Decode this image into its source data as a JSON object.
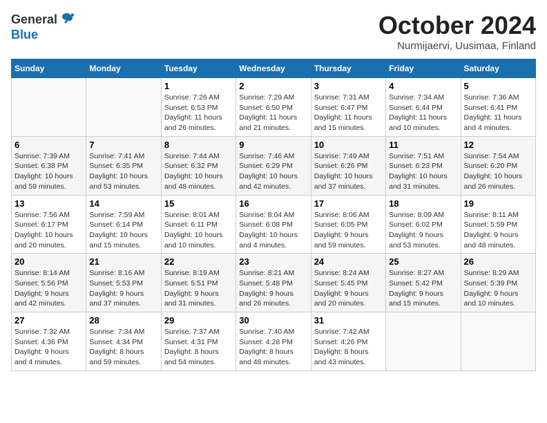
{
  "header": {
    "logo_general": "General",
    "logo_blue": "Blue",
    "month_title": "October 2024",
    "location": "Nurmijaervi, Uusimaa, Finland"
  },
  "weekdays": [
    "Sunday",
    "Monday",
    "Tuesday",
    "Wednesday",
    "Thursday",
    "Friday",
    "Saturday"
  ],
  "weeks": [
    [
      {
        "day": "",
        "info": ""
      },
      {
        "day": "",
        "info": ""
      },
      {
        "day": "1",
        "info": "Sunrise: 7:26 AM\nSunset: 6:53 PM\nDaylight: 11 hours\nand 26 minutes."
      },
      {
        "day": "2",
        "info": "Sunrise: 7:29 AM\nSunset: 6:50 PM\nDaylight: 11 hours\nand 21 minutes."
      },
      {
        "day": "3",
        "info": "Sunrise: 7:31 AM\nSunset: 6:47 PM\nDaylight: 11 hours\nand 15 minutes."
      },
      {
        "day": "4",
        "info": "Sunrise: 7:34 AM\nSunset: 6:44 PM\nDaylight: 11 hours\nand 10 minutes."
      },
      {
        "day": "5",
        "info": "Sunrise: 7:36 AM\nSunset: 6:41 PM\nDaylight: 11 hours\nand 4 minutes."
      }
    ],
    [
      {
        "day": "6",
        "info": "Sunrise: 7:39 AM\nSunset: 6:38 PM\nDaylight: 10 hours\nand 59 minutes."
      },
      {
        "day": "7",
        "info": "Sunrise: 7:41 AM\nSunset: 6:35 PM\nDaylight: 10 hours\nand 53 minutes."
      },
      {
        "day": "8",
        "info": "Sunrise: 7:44 AM\nSunset: 6:32 PM\nDaylight: 10 hours\nand 48 minutes."
      },
      {
        "day": "9",
        "info": "Sunrise: 7:46 AM\nSunset: 6:29 PM\nDaylight: 10 hours\nand 42 minutes."
      },
      {
        "day": "10",
        "info": "Sunrise: 7:49 AM\nSunset: 6:26 PM\nDaylight: 10 hours\nand 37 minutes."
      },
      {
        "day": "11",
        "info": "Sunrise: 7:51 AM\nSunset: 6:23 PM\nDaylight: 10 hours\nand 31 minutes."
      },
      {
        "day": "12",
        "info": "Sunrise: 7:54 AM\nSunset: 6:20 PM\nDaylight: 10 hours\nand 26 minutes."
      }
    ],
    [
      {
        "day": "13",
        "info": "Sunrise: 7:56 AM\nSunset: 6:17 PM\nDaylight: 10 hours\nand 20 minutes."
      },
      {
        "day": "14",
        "info": "Sunrise: 7:59 AM\nSunset: 6:14 PM\nDaylight: 10 hours\nand 15 minutes."
      },
      {
        "day": "15",
        "info": "Sunrise: 8:01 AM\nSunset: 6:11 PM\nDaylight: 10 hours\nand 10 minutes."
      },
      {
        "day": "16",
        "info": "Sunrise: 8:04 AM\nSunset: 6:08 PM\nDaylight: 10 hours\nand 4 minutes."
      },
      {
        "day": "17",
        "info": "Sunrise: 8:06 AM\nSunset: 6:05 PM\nDaylight: 9 hours\nand 59 minutes."
      },
      {
        "day": "18",
        "info": "Sunrise: 8:09 AM\nSunset: 6:02 PM\nDaylight: 9 hours\nand 53 minutes."
      },
      {
        "day": "19",
        "info": "Sunrise: 8:11 AM\nSunset: 5:59 PM\nDaylight: 9 hours\nand 48 minutes."
      }
    ],
    [
      {
        "day": "20",
        "info": "Sunrise: 8:14 AM\nSunset: 5:56 PM\nDaylight: 9 hours\nand 42 minutes."
      },
      {
        "day": "21",
        "info": "Sunrise: 8:16 AM\nSunset: 5:53 PM\nDaylight: 9 hours\nand 37 minutes."
      },
      {
        "day": "22",
        "info": "Sunrise: 8:19 AM\nSunset: 5:51 PM\nDaylight: 9 hours\nand 31 minutes."
      },
      {
        "day": "23",
        "info": "Sunrise: 8:21 AM\nSunset: 5:48 PM\nDaylight: 9 hours\nand 26 minutes."
      },
      {
        "day": "24",
        "info": "Sunrise: 8:24 AM\nSunset: 5:45 PM\nDaylight: 9 hours\nand 20 minutes."
      },
      {
        "day": "25",
        "info": "Sunrise: 8:27 AM\nSunset: 5:42 PM\nDaylight: 9 hours\nand 15 minutes."
      },
      {
        "day": "26",
        "info": "Sunrise: 8:29 AM\nSunset: 5:39 PM\nDaylight: 9 hours\nand 10 minutes."
      }
    ],
    [
      {
        "day": "27",
        "info": "Sunrise: 7:32 AM\nSunset: 4:36 PM\nDaylight: 9 hours\nand 4 minutes."
      },
      {
        "day": "28",
        "info": "Sunrise: 7:34 AM\nSunset: 4:34 PM\nDaylight: 8 hours\nand 59 minutes."
      },
      {
        "day": "29",
        "info": "Sunrise: 7:37 AM\nSunset: 4:31 PM\nDaylight: 8 hours\nand 54 minutes."
      },
      {
        "day": "30",
        "info": "Sunrise: 7:40 AM\nSunset: 4:28 PM\nDaylight: 8 hours\nand 48 minutes."
      },
      {
        "day": "31",
        "info": "Sunrise: 7:42 AM\nSunset: 4:26 PM\nDaylight: 8 hours\nand 43 minutes."
      },
      {
        "day": "",
        "info": ""
      },
      {
        "day": "",
        "info": ""
      }
    ]
  ]
}
